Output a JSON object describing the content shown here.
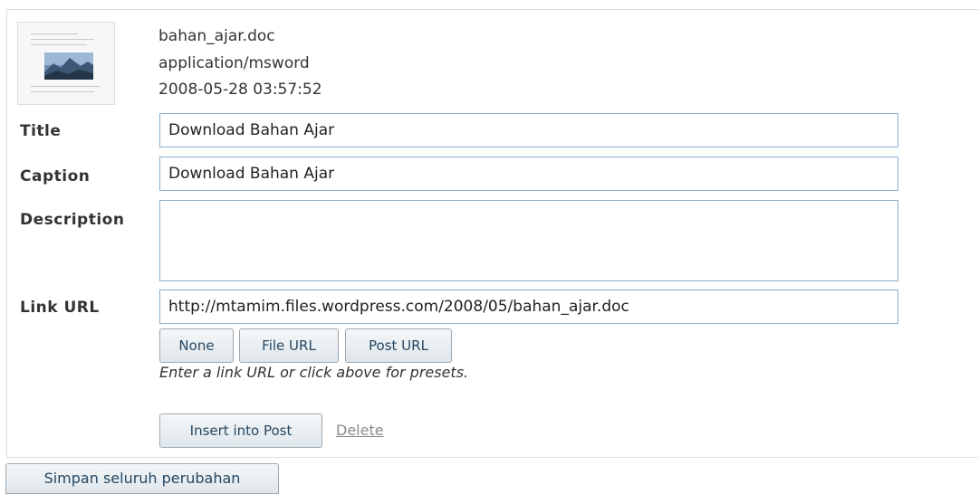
{
  "attachment": {
    "filename": "bahan_ajar.doc",
    "mime_type": "application/msword",
    "date": "2008-05-28 03:57:52",
    "thumbnail_icon": "document-icon"
  },
  "fields": {
    "title": {
      "label": "Title",
      "value": "Download Bahan Ajar"
    },
    "caption": {
      "label": "Caption",
      "value": "Download Bahan Ajar"
    },
    "description": {
      "label": "Description",
      "value": ""
    },
    "link_url": {
      "label": "Link URL",
      "value": "http://mtamim.files.wordpress.com/2008/05/bahan_ajar.doc"
    }
  },
  "url_buttons": {
    "none": "None",
    "file_url": "File URL",
    "post_url": "Post URL"
  },
  "help_text": "Enter a link URL or click above for presets.",
  "actions": {
    "insert": "Insert into Post",
    "delete": "Delete",
    "save_all": "Simpan seluruh perubahan"
  },
  "colors": {
    "input_border": "#8bafcf",
    "button_text": "#264761",
    "delete_link": "#8a8a8a"
  }
}
